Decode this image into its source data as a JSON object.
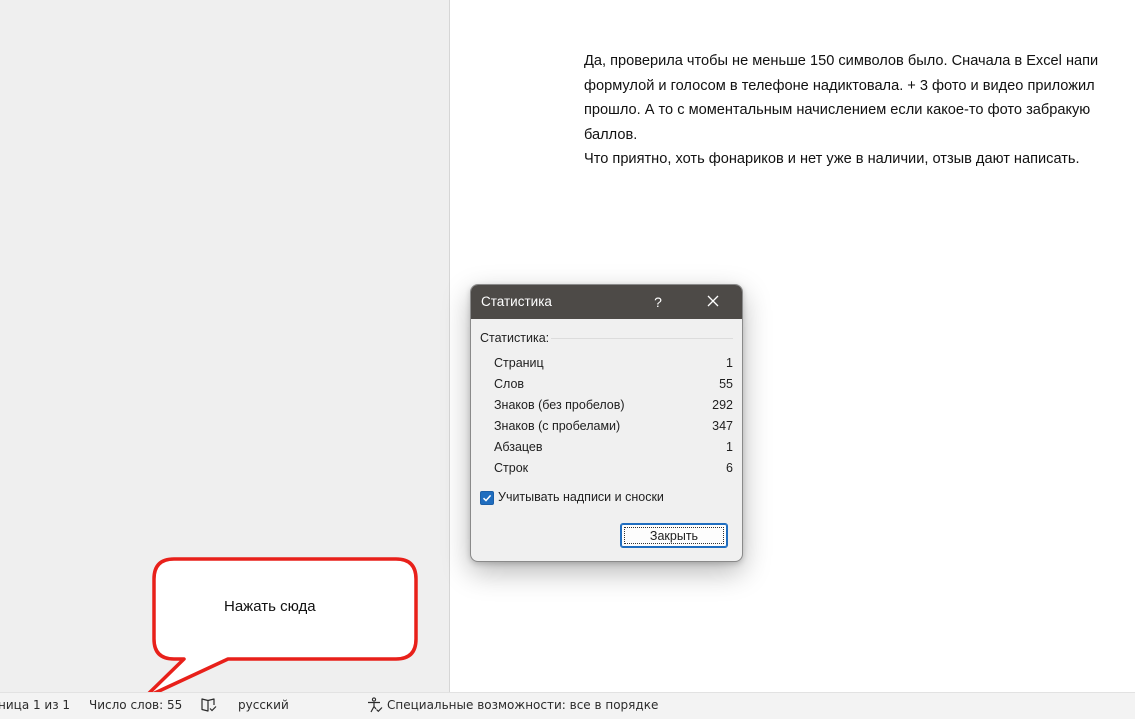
{
  "document": {
    "lines": [
      "Да, проверила чтобы не меньше 150 символов было. Сначала в Excel напи",
      "формулой и голосом в телефоне надиктовала. + 3 фото и видео приложил",
      "прошло. А то с моментальным начислением если какое-то фото забракую",
      "баллов.",
      "Что приятно, хоть фонариков и нет уже в наличии, отзыв дают написать."
    ]
  },
  "dialog": {
    "title": "Статистика",
    "help_label": "?",
    "group_label": "Статистика:",
    "stats": [
      {
        "label": "Страниц",
        "value": "1"
      },
      {
        "label": "Слов",
        "value": "55"
      },
      {
        "label": "Знаков (без пробелов)",
        "value": "292"
      },
      {
        "label": "Знаков (с пробелами)",
        "value": "347"
      },
      {
        "label": "Абзацев",
        "value": "1"
      },
      {
        "label": "Строк",
        "value": "6"
      }
    ],
    "checkbox_label": "Учитывать надписи и сноски",
    "checkbox_checked": true,
    "close_button": "Закрыть"
  },
  "callout": {
    "text": "Нажать сюда",
    "color": "#e8201a"
  },
  "statusbar": {
    "page_info": "ница 1 из 1",
    "word_count": "Число слов: 55",
    "language": "русский",
    "accessibility": "Специальные возможности: все в порядке"
  },
  "icons": {
    "proofing": "book-check-icon",
    "accessibility": "accessibility-icon",
    "close": "close-icon"
  }
}
